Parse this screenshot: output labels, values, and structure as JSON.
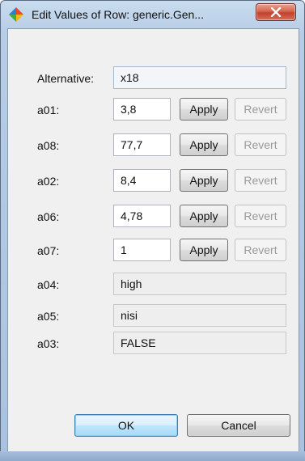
{
  "window": {
    "title": "Edit Values of Row: generic.Gen...",
    "icon": "colorful-app-icon",
    "close_icon": "close-icon"
  },
  "alternative": {
    "label": "Alternative:",
    "value": "x18"
  },
  "editable_rows": [
    {
      "label": "a01:",
      "value": "3,8",
      "apply": "Apply",
      "revert": "Revert"
    },
    {
      "label": "a08:",
      "value": "77,7",
      "apply": "Apply",
      "revert": "Revert"
    },
    {
      "label": "a02:",
      "value": "8,4",
      "apply": "Apply",
      "revert": "Revert"
    },
    {
      "label": "a06:",
      "value": "4,78",
      "apply": "Apply",
      "revert": "Revert"
    },
    {
      "label": "a07:",
      "value": "1",
      "apply": "Apply",
      "revert": "Revert"
    }
  ],
  "readonly_rows": [
    {
      "label": "a04:",
      "value": "high"
    },
    {
      "label": "a05:",
      "value": "nisi"
    },
    {
      "label": "a03:",
      "value": "FALSE"
    }
  ],
  "buttons": {
    "ok": "OK",
    "cancel": "Cancel"
  },
  "colors": {
    "primary_button_border": "#3c7fb1",
    "close_button": "#c2412b",
    "dialog_background": "#f0f0f0"
  }
}
